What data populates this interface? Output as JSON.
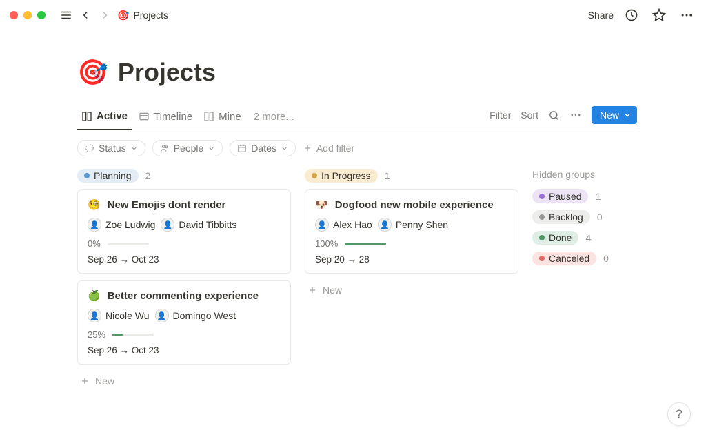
{
  "breadcrumb": {
    "icon": "🎯",
    "title": "Projects"
  },
  "topbar": {
    "share": "Share"
  },
  "page": {
    "icon": "🎯",
    "title": "Projects"
  },
  "views": {
    "tabs": [
      {
        "label": "Active",
        "active": true
      },
      {
        "label": "Timeline",
        "active": false
      },
      {
        "label": "Mine",
        "active": false
      }
    ],
    "more": "2 more..."
  },
  "actions": {
    "filter": "Filter",
    "sort": "Sort",
    "new": "New"
  },
  "filters": {
    "chips": [
      {
        "label": "Status"
      },
      {
        "label": "People"
      },
      {
        "label": "Dates"
      }
    ],
    "add": "Add filter"
  },
  "board": {
    "columns": [
      {
        "name": "Planning",
        "tag_bg": "#e4ecf6",
        "tag_dot": "#5b97d1",
        "count": "2",
        "cards": [
          {
            "emoji": "🧐",
            "title": "New Emojis dont  render",
            "people": [
              {
                "name": "Zoe Ludwig"
              },
              {
                "name": "David Tibbitts"
              }
            ],
            "progress_label": "0%",
            "progress_pct": 0,
            "dates": "Sep 26 → Oct 23"
          },
          {
            "emoji": "🍏",
            "title": "Better commenting experience",
            "people": [
              {
                "name": "Nicole Wu"
              },
              {
                "name": "Domingo West"
              }
            ],
            "progress_label": "25%",
            "progress_pct": 25,
            "dates": "Sep 26 → Oct 23"
          }
        ],
        "add": "New"
      },
      {
        "name": "In Progress",
        "tag_bg": "#faecd0",
        "tag_dot": "#d6a24a",
        "count": "1",
        "cards": [
          {
            "emoji": "🐶",
            "title": "Dogfood new mobile experience",
            "people": [
              {
                "name": "Alex Hao"
              },
              {
                "name": "Penny Shen"
              }
            ],
            "progress_label": "100%",
            "progress_pct": 100,
            "dates": "Sep 20 → 28"
          }
        ],
        "add": "New"
      }
    ],
    "hidden_title": "Hidden groups",
    "hidden": [
      {
        "name": "Paused",
        "tag_bg": "#ece4f5",
        "tag_dot": "#9a6dd7",
        "count": "1"
      },
      {
        "name": "Backlog",
        "tag_bg": "#ededec",
        "tag_dot": "#9b9a97",
        "count": "0"
      },
      {
        "name": "Done",
        "tag_bg": "#dfeee4",
        "tag_dot": "#4f9768",
        "count": "4"
      },
      {
        "name": "Canceled",
        "tag_bg": "#fae3e1",
        "tag_dot": "#e16b64",
        "count": "0"
      }
    ]
  },
  "help": "?"
}
